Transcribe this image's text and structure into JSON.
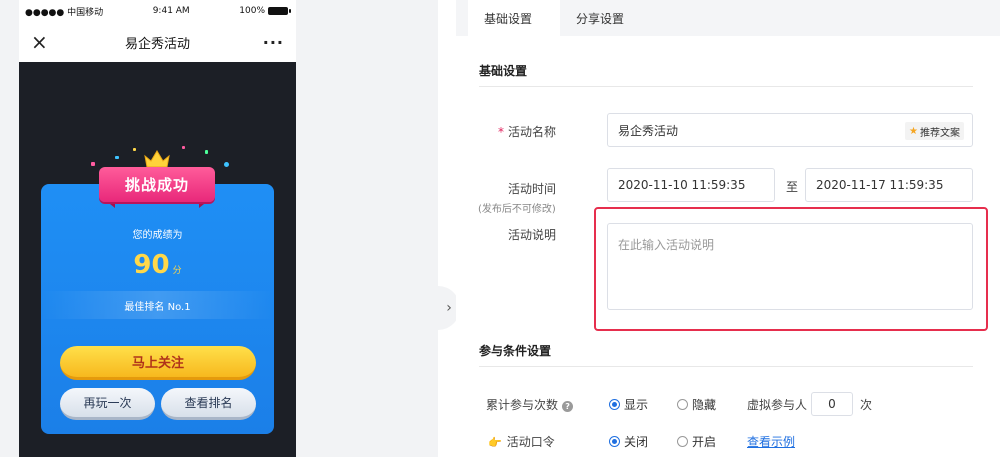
{
  "phone": {
    "status": {
      "carrier": "●●●●● 中国移动",
      "time": "9:41 AM",
      "battery": "100%"
    },
    "nav": {
      "title": "易企秀活动",
      "close_icon": "×",
      "more_icon": "···"
    },
    "game": {
      "banner": "挑战成功",
      "score_label": "您的成绩为",
      "score": "90",
      "score_unit": "分",
      "rank": "最佳排名 No.1",
      "follow_button": "马上关注",
      "replay_button": "再玩一次",
      "ranking_button": "查看排名"
    },
    "colors": {
      "banner": "#e8287a",
      "card": "#1f8ff5",
      "score": "#ffd84a",
      "follow": "#f7b81e"
    }
  },
  "toggle_icon": "›",
  "tabs": [
    {
      "label": "基础设置",
      "active": true
    },
    {
      "label": "分享设置",
      "active": false
    }
  ],
  "basic": {
    "section_title": "基础设置",
    "name_label": "活动名称",
    "name_required": "*",
    "name_value": "易企秀活动",
    "recommend_tag": "推荐文案",
    "time_label": "活动时间",
    "time_note": "(发布后不可修改)",
    "start_time": "2020-11-10 11:59:35",
    "to": "至",
    "end_time": "2020-11-17 11:59:35",
    "desc_label": "活动说明",
    "desc_placeholder": "在此输入活动说明"
  },
  "conditions": {
    "section_title": "参与条件设置",
    "count_label": "累计参与次数",
    "help_icon": "?",
    "show": "显示",
    "hide": "隐藏",
    "virtual_label": "虚拟参与人",
    "virtual_value": "0",
    "times_unit": "次",
    "password_label": "活动口令",
    "password_icon": "👉",
    "off": "关闭",
    "on": "开启",
    "example_link": "查看示例"
  },
  "accent": "#1f6fe0",
  "highlight_color": "#e62e4d"
}
